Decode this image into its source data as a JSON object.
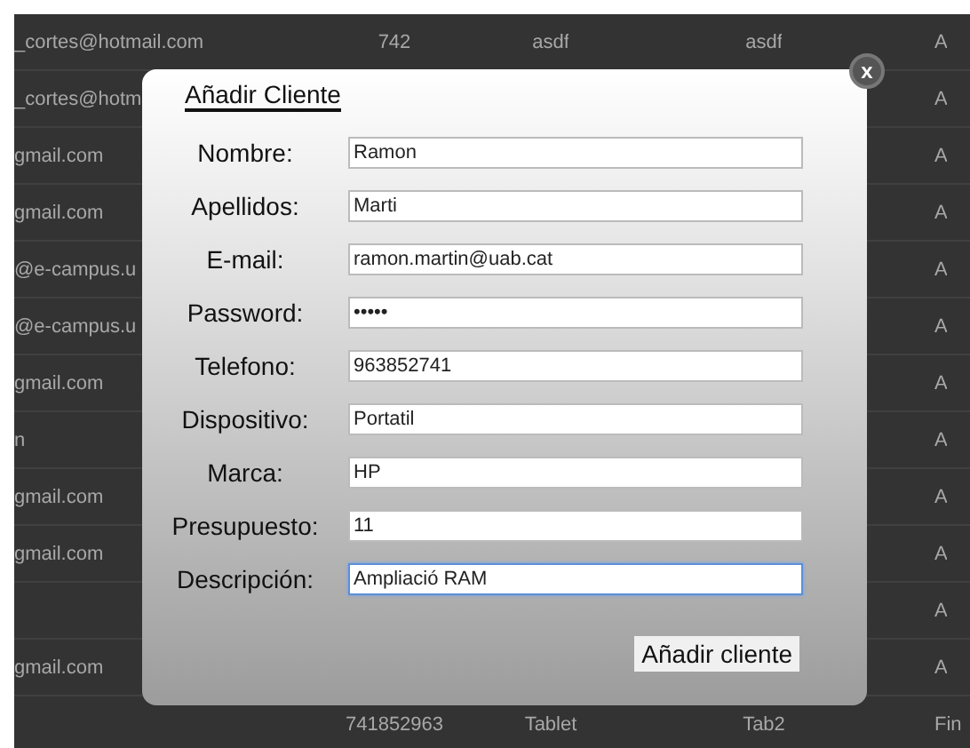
{
  "table": {
    "rows": [
      {
        "cells": [
          "_cortes@hotmail.com",
          "742",
          "asdf",
          "asdf",
          "A"
        ]
      },
      {
        "cells": [
          "_cortes@hotm",
          "",
          "",
          "",
          "A"
        ]
      },
      {
        "cells": [
          "gmail.com",
          "",
          "",
          "",
          "A"
        ]
      },
      {
        "cells": [
          "gmail.com",
          "",
          "",
          "",
          "A"
        ]
      },
      {
        "cells": [
          "@e-campus.u",
          "",
          "",
          "",
          "A"
        ]
      },
      {
        "cells": [
          "@e-campus.u",
          "",
          "",
          "",
          "A"
        ]
      },
      {
        "cells": [
          "gmail.com",
          "",
          "",
          "",
          "A"
        ]
      },
      {
        "cells": [
          "n",
          "",
          "",
          "",
          "A"
        ]
      },
      {
        "cells": [
          "gmail.com",
          "",
          "",
          "",
          "A"
        ]
      },
      {
        "cells": [
          "gmail.com",
          "",
          "",
          "",
          "A"
        ]
      },
      {
        "cells": [
          "",
          "",
          "",
          "",
          "A"
        ]
      },
      {
        "cells": [
          "gmail.com",
          "",
          "",
          "",
          "A"
        ]
      },
      {
        "cells": [
          "",
          "741852963",
          "Tablet",
          "Tab2",
          "Fin"
        ]
      }
    ]
  },
  "modal": {
    "title": "Añadir Cliente",
    "close": "x",
    "fields": [
      {
        "label": "Nombre:",
        "value": "Ramon",
        "focused": false
      },
      {
        "label": "Apellidos:",
        "value": "Marti",
        "focused": false
      },
      {
        "label": "E-mail:",
        "value": "ramon.martin@uab.cat",
        "focused": false
      },
      {
        "label": "Password:",
        "value": "•••••",
        "focused": false
      },
      {
        "label": "Telefono:",
        "value": "963852741",
        "focused": false
      },
      {
        "label": "Dispositivo:",
        "value": "Portatil",
        "focused": false
      },
      {
        "label": "Marca:",
        "value": "HP",
        "focused": false
      },
      {
        "label": "Presupuesto:",
        "value": "11",
        "focused": false
      },
      {
        "label": "Descripción:",
        "value": "Ampliació RAM",
        "focused": true
      }
    ],
    "submit": "Añadir cliente"
  }
}
